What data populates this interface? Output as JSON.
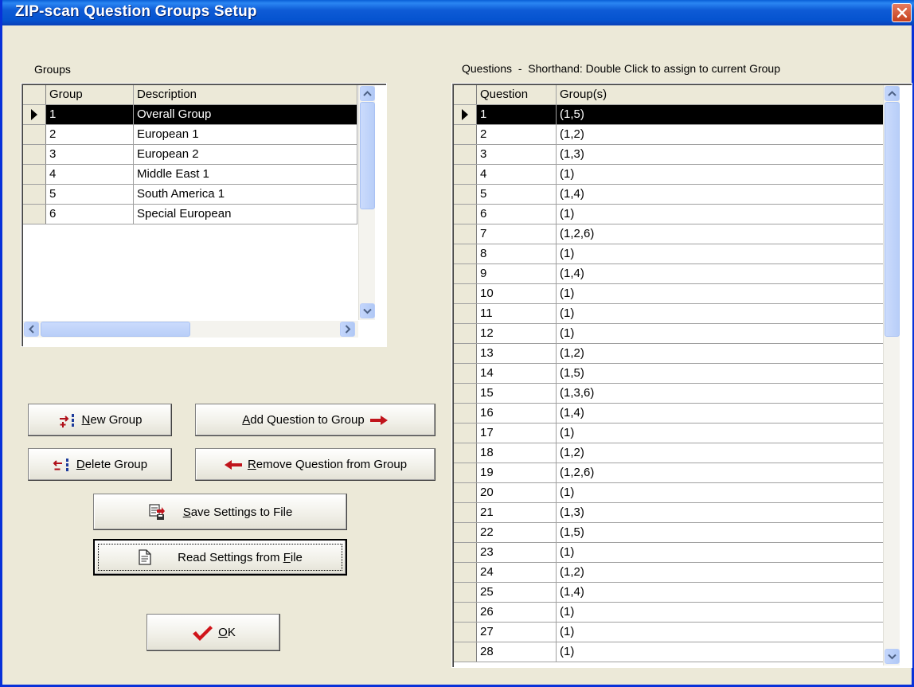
{
  "window": {
    "title": "ZIP-scan Question Groups Setup"
  },
  "groups": {
    "label": "Groups",
    "columns": [
      "Group",
      "Description"
    ],
    "rows": [
      {
        "group": "1",
        "description": "Overall Group"
      },
      {
        "group": "2",
        "description": "European 1"
      },
      {
        "group": "3",
        "description": "European 2"
      },
      {
        "group": "4",
        "description": "Middle East 1"
      },
      {
        "group": "5",
        "description": "South America 1"
      },
      {
        "group": "6",
        "description": "Special European"
      }
    ],
    "selected_row": 0
  },
  "questions": {
    "label": "Questions  -  Shorthand: Double Click to assign to current Group",
    "columns": [
      "Question",
      "Group(s)"
    ],
    "rows": [
      {
        "q": "1",
        "g": "(1,5)"
      },
      {
        "q": "2",
        "g": "(1,2)"
      },
      {
        "q": "3",
        "g": "(1,3)"
      },
      {
        "q": "4",
        "g": "(1)"
      },
      {
        "q": "5",
        "g": "(1,4)"
      },
      {
        "q": "6",
        "g": "(1)"
      },
      {
        "q": "7",
        "g": "(1,2,6)"
      },
      {
        "q": "8",
        "g": "(1)"
      },
      {
        "q": "9",
        "g": "(1,4)"
      },
      {
        "q": "10",
        "g": "(1)"
      },
      {
        "q": "11",
        "g": "(1)"
      },
      {
        "q": "12",
        "g": "(1)"
      },
      {
        "q": "13",
        "g": "(1,2)"
      },
      {
        "q": "14",
        "g": "(1,5)"
      },
      {
        "q": "15",
        "g": "(1,3,6)"
      },
      {
        "q": "16",
        "g": "(1,4)"
      },
      {
        "q": "17",
        "g": "(1)"
      },
      {
        "q": "18",
        "g": "(1,2)"
      },
      {
        "q": "19",
        "g": "(1,2,6)"
      },
      {
        "q": "20",
        "g": "(1)"
      },
      {
        "q": "21",
        "g": "(1,3)"
      },
      {
        "q": "22",
        "g": "(1,5)"
      },
      {
        "q": "23",
        "g": "(1)"
      },
      {
        "q": "24",
        "g": "(1,2)"
      },
      {
        "q": "25",
        "g": "(1,4)"
      },
      {
        "q": "26",
        "g": "(1)"
      },
      {
        "q": "27",
        "g": "(1)"
      },
      {
        "q": "28",
        "g": "(1)"
      }
    ],
    "selected_row": 0
  },
  "buttons": {
    "new_group": {
      "mnemonic": "N",
      "rest": "ew Group"
    },
    "delete_group": {
      "mnemonic": "D",
      "rest": "elete Group"
    },
    "add_question": {
      "pre": "",
      "mnemonic": "A",
      "rest": "dd Question to Group"
    },
    "remove_question": {
      "mnemonic": "R",
      "rest": "emove Question from Group"
    },
    "save_settings": {
      "mnemonic": "S",
      "rest": "ave Settings to File"
    },
    "read_settings": {
      "pre": "Read Settings from ",
      "mnemonic": "F",
      "rest": "ile"
    },
    "ok": {
      "mnemonic": "O",
      "rest": "K"
    }
  },
  "colors": {
    "title_bar": "#0553CF",
    "selection": "#000000",
    "arrow_red": "#C0141C",
    "checkmark": "#D0141A"
  },
  "icons": [
    "close-icon",
    "new-group-icon",
    "delete-group-icon",
    "right-arrow-icon",
    "left-arrow-icon",
    "save-file-icon",
    "read-file-icon",
    "checkmark-icon",
    "row-pointer-icon"
  ]
}
